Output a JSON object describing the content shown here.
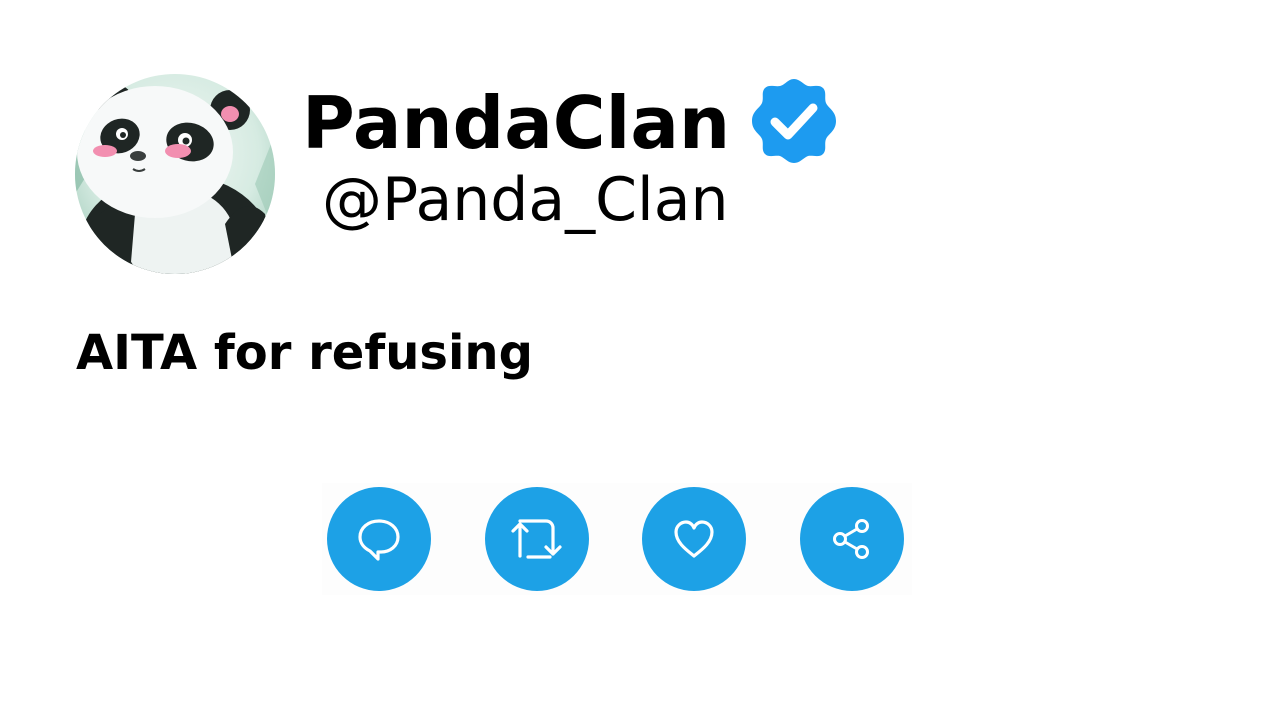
{
  "profile": {
    "display_name": "PandaClan",
    "handle": "@Panda_Clan",
    "verified": true,
    "avatar": "panda-avatar"
  },
  "post": {
    "text": "AITA for refusing"
  },
  "actions": [
    {
      "icon": "reply-icon"
    },
    {
      "icon": "retweet-icon"
    },
    {
      "icon": "heart-icon"
    },
    {
      "icon": "share-icon"
    }
  ],
  "colors": {
    "accent": "#1da1e6",
    "badge": "#1d9bf0",
    "text": "#000000",
    "background": "#ffffff"
  }
}
